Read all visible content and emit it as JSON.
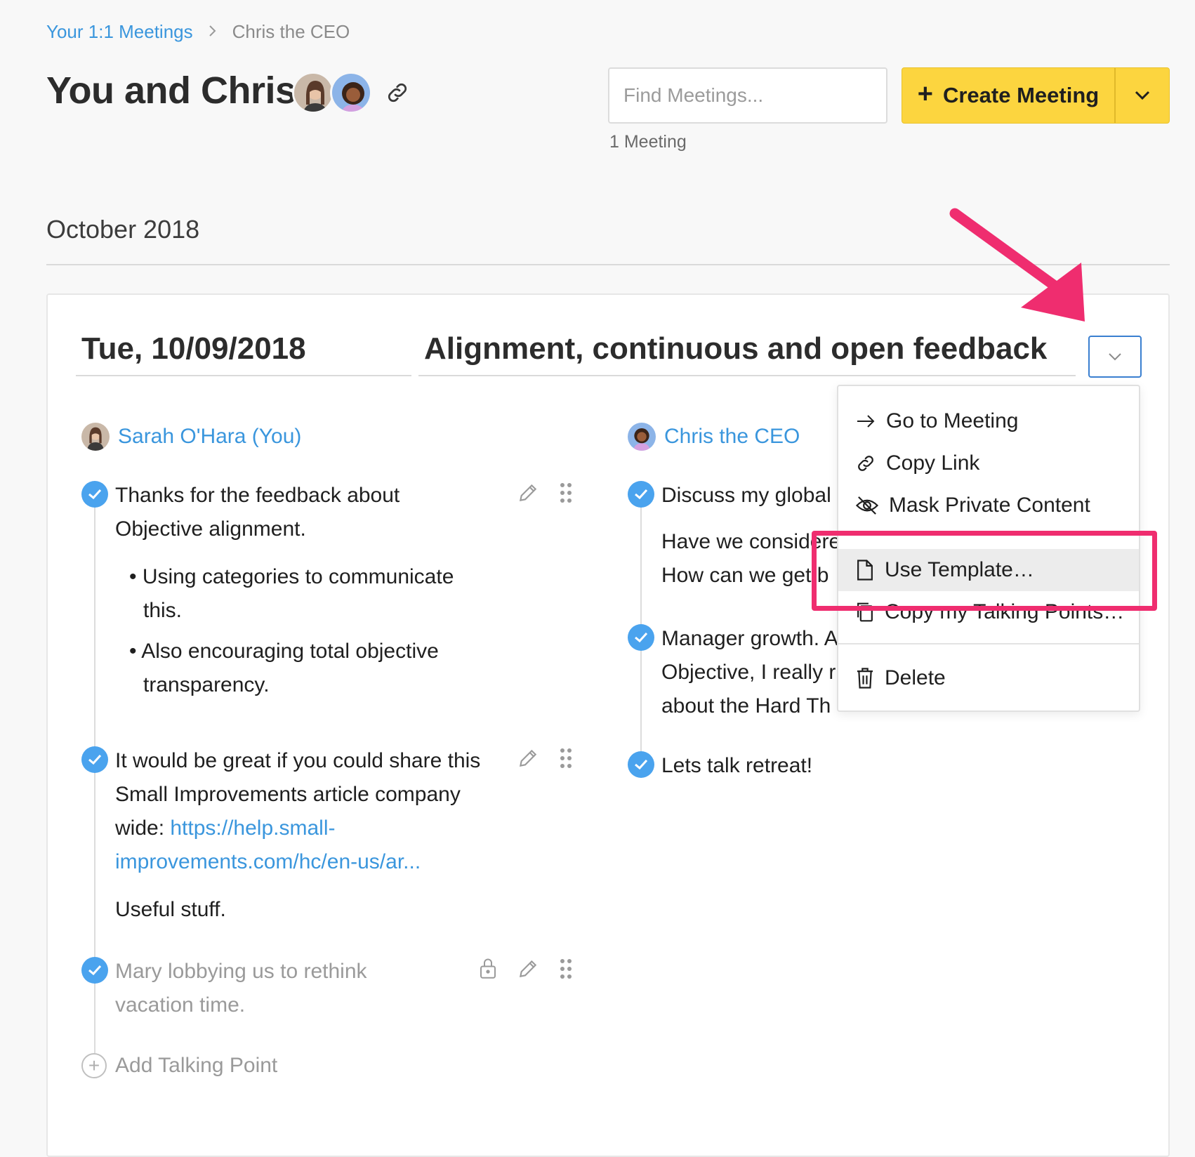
{
  "breadcrumb": {
    "parent": "Your 1:1 Meetings",
    "separator": ">",
    "current": "Chris the CEO"
  },
  "page_title": "You and Chris",
  "search": {
    "placeholder": "Find Meetings..."
  },
  "meeting_count": "1 Meeting",
  "create_button": {
    "label": "Create Meeting",
    "plus": "+"
  },
  "month_heading": "October 2018",
  "meeting": {
    "date": "Tue, 10/09/2018",
    "title": "Alignment, continuous and open feedback"
  },
  "left": {
    "person": "Sarah O'Hara (You)",
    "items": [
      {
        "line1": "Thanks for the feedback about",
        "line2": "Objective alignment.",
        "bullets": [
          {
            "l1": "Using categories to communicate",
            "l2": "this."
          },
          {
            "l1": "Also encouraging total objective",
            "l2": "transparency."
          }
        ]
      },
      {
        "line1": "It would be great if you could share this",
        "line2": "Small Improvements article company",
        "line3_prefix": "wide: ",
        "link1": "https://help.small-",
        "link2": "improvements.com/hc/en-us/ar...",
        "note": "Useful stuff."
      },
      {
        "line1": "Mary lobbying us to rethink",
        "line2": "vacation time."
      }
    ],
    "add_label": "Add Talking Point"
  },
  "right": {
    "person": "Chris the CEO",
    "items": [
      {
        "line1": "Discuss my global",
        "sub1": "Have we considere",
        "sub2": "How can we get b"
      },
      {
        "line1": "Manager growth. A",
        "line2": "Objective, I really r",
        "line3": "about the Hard Th"
      },
      {
        "line1": "Lets talk retreat!"
      }
    ]
  },
  "menu": {
    "items": [
      {
        "label": "Go to Meeting",
        "icon": "arrow-right-icon"
      },
      {
        "label": "Copy Link",
        "icon": "link-icon"
      },
      {
        "label": "Mask Private Content",
        "icon": "eye-off-icon"
      },
      {
        "label": "Use Template…",
        "icon": "document-icon"
      },
      {
        "label": "Copy my Talking Points…",
        "icon": "copy-icon"
      },
      {
        "label": "Delete",
        "icon": "trash-icon"
      }
    ]
  },
  "colors": {
    "accent": "#3a96dd",
    "cta": "#fcd53f",
    "annotation": "#ef2d6f",
    "check": "#4aa3ee"
  }
}
